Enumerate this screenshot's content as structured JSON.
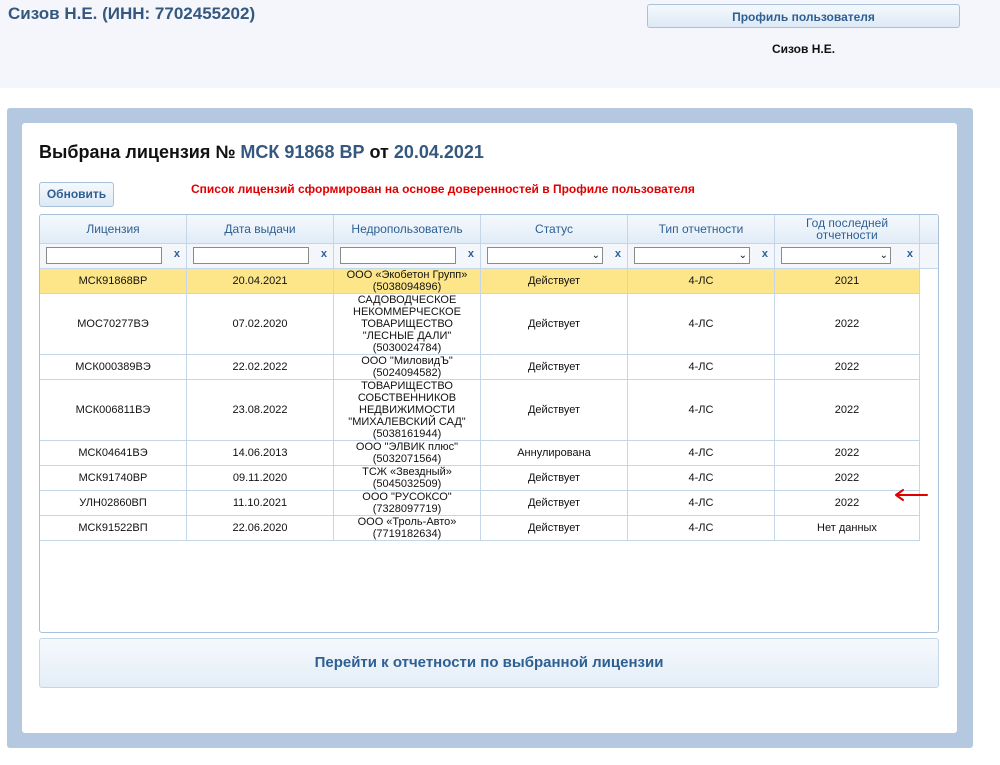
{
  "header": {
    "user_title": "Сизов Н.Е. (ИНН: 7702455202)",
    "profile_button": "Профиль пользователя",
    "profile_name": "Сизов Н.Е."
  },
  "license": {
    "prefix": "Выбрана лицензия № ",
    "number": "МСК 91868 ВР",
    "middle": " от ",
    "date": "20.04.2021"
  },
  "toolbar": {
    "refresh_label": "Обновить",
    "notice": "Список лицензий сформирован на основе доверенностей в Профиле пользователя"
  },
  "table": {
    "columns": [
      "Лицензия",
      "Дата выдачи",
      "Недропользователь",
      "Статус",
      "Тип отчетности",
      "Год последней отчетности"
    ],
    "filter_clear": "x",
    "selected_index": 0,
    "rows": [
      {
        "license": "МСК91868ВР",
        "date": "20.04.2021",
        "user": [
          "ООО «Экобетон Групп»",
          "(5038094896)"
        ],
        "status": "Действует",
        "type": "4-ЛС",
        "year": "2021"
      },
      {
        "license": "МОС70277ВЭ",
        "date": "07.02.2020",
        "user": [
          "САДОВОДЧЕСКОЕ",
          "НЕКОММЕРЧЕСКОЕ",
          "ТОВАРИЩЕСТВО",
          "\"ЛЕСНЫЕ ДАЛИ\"",
          "(5030024784)"
        ],
        "status": "Действует",
        "type": "4-ЛС",
        "year": "2022"
      },
      {
        "license": "МСК000389ВЭ",
        "date": "22.02.2022",
        "user": [
          "ООО \"МиловидЪ\"",
          "(5024094582)"
        ],
        "status": "Действует",
        "type": "4-ЛС",
        "year": "2022"
      },
      {
        "license": "МСК006811ВЭ",
        "date": "23.08.2022",
        "user": [
          "ТОВАРИЩЕСТВО",
          "СОБСТВЕННИКОВ",
          "НЕДВИЖИМОСТИ",
          "\"МИХАЛЕВСКИЙ САД\"",
          "(5038161944)"
        ],
        "status": "Действует",
        "type": "4-ЛС",
        "year": "2022"
      },
      {
        "license": "МСК04641ВЭ",
        "date": "14.06.2013",
        "user": [
          "ООО \"ЭЛВИК плюс\"",
          "(5032071564)"
        ],
        "status": "Аннулирована",
        "type": "4-ЛС",
        "year": "2022"
      },
      {
        "license": "МСК91740ВР",
        "date": "09.11.2020",
        "user": [
          "ТСЖ «Звездный»",
          "(5045032509)"
        ],
        "status": "Действует",
        "type": "4-ЛС",
        "year": "2022"
      },
      {
        "license": "УЛН02860ВП",
        "date": "11.10.2021",
        "user": [
          "ООО \"РУСОКСО\"",
          "(7328097719)"
        ],
        "status": "Действует",
        "type": "4-ЛС",
        "year": "2022"
      },
      {
        "license": "МСК91522ВП",
        "date": "22.06.2020",
        "user": [
          "ООО «Троль-Авто»",
          "(7719182634)"
        ],
        "status": "Действует",
        "type": "4-ЛС",
        "year": "Нет данных"
      }
    ]
  },
  "go_button": "Перейти к отчетности по выбранной лицензии",
  "colors": {
    "accent": "#35587f",
    "notice": "#e00000",
    "selected_row": "#fde68a",
    "annotation_arrow": "#e00000"
  },
  "icons": {
    "annotation": "red-arrow-icon",
    "select": "chevron-down-icon"
  }
}
